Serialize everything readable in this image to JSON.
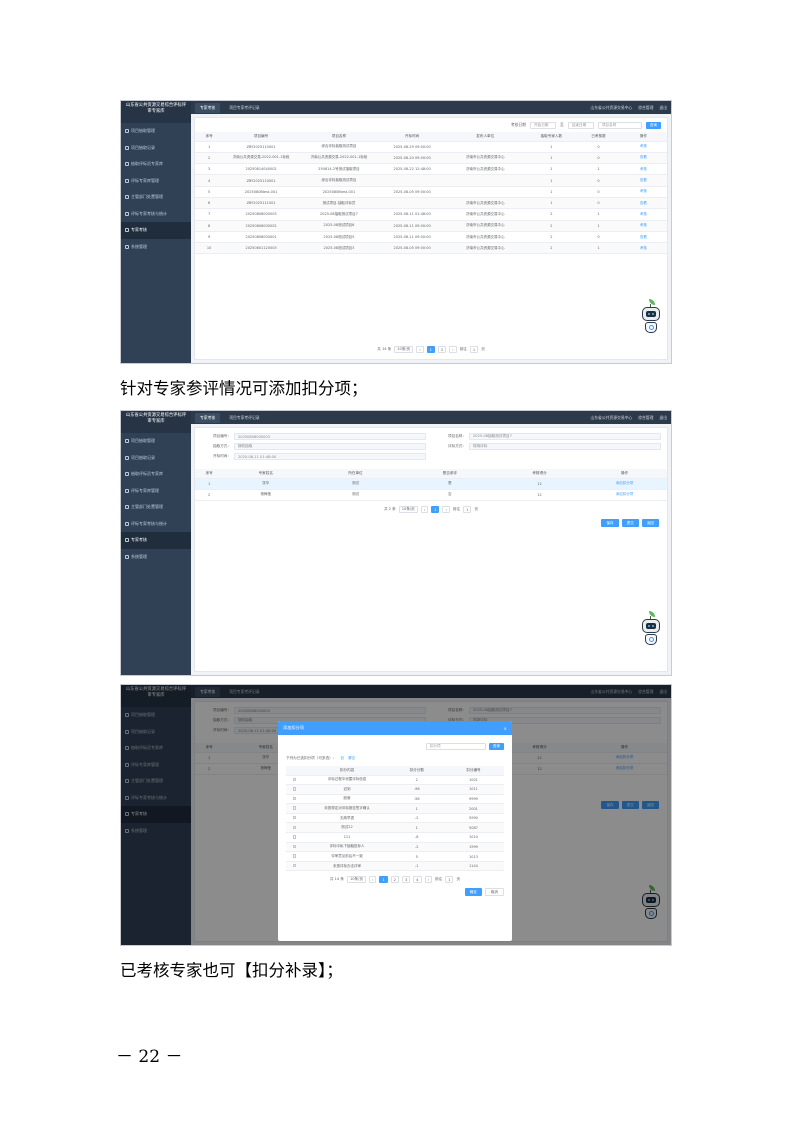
{
  "app": {
    "brand": "山东省公共资源交易综合评标评审专家库",
    "sidebar": [
      "项目抽取管理",
      "项目抽取记录",
      "抽取评标员专家库",
      "评标专家库管理",
      "主管部门处置管理",
      "评标专家考核与统计",
      "专家考核",
      "系统管理"
    ],
    "sidebar_active": 6,
    "tabs": [
      "专家考核",
      "项目专家考评记录"
    ],
    "top_right": [
      "山东省公共资源交易中心",
      "综合管理",
      "退出"
    ]
  },
  "shot1": {
    "filter": {
      "label": "考核日期",
      "range_start": "开始日期",
      "range_sep": "至",
      "range_end": "结束日期",
      "keyword": "项目名称",
      "search": "查询"
    },
    "columns": [
      "序号",
      "项目编号",
      "项目名称",
      "开标时间",
      "发布人单位",
      "抽取专家人数",
      "已考核数",
      "操作"
    ],
    "rows": [
      [
        "1",
        "ZBY2025110001",
        "综合评标抽取测试项目",
        "2025-08-29 09:00:00",
        "",
        "1",
        "0",
        "考核"
      ],
      [
        "2",
        "济南公共资源交易-2022-001-1标段",
        "济南公共资源交易-2022-001-1标段",
        "2025-08-20 09:00:00",
        "济南市公共资源交易中心",
        "1",
        "0",
        "查看"
      ],
      [
        "3",
        "20250814040002",
        "250814-2号测试抽取项目",
        "2025-08-22 12:48:00",
        "济南市公共资源交易中心",
        "1",
        "1",
        "考核"
      ],
      [
        "4",
        "ZBY2025110001",
        "综合评标抽取测试项目",
        "",
        "",
        "1",
        "0",
        "查看"
      ],
      [
        "5",
        "20250808test-001",
        "20250808test-001",
        "2025-08-05 09:00:00",
        "",
        "1",
        "0",
        "考核"
      ],
      [
        "6",
        "ZBY2025111001",
        "测试项目-抽取评标员",
        "",
        "济南市公共资源交易中心",
        "1",
        "0",
        "查看"
      ],
      [
        "7",
        "20250806000003",
        "2025-08抽取测试项目7",
        "2025-08-11 01:48:00",
        "济南市公共资源交易中心",
        "2",
        "1",
        "考核"
      ],
      [
        "8",
        "20250806000002",
        "2025-08测试项目6",
        "2025-08-11 09:00:00",
        "济南市公共资源交易中心",
        "2",
        "1",
        "考核"
      ],
      [
        "9",
        "20250806000001",
        "2025-08测试项目5",
        "2025-08-11 09:00:00",
        "济南市公共资源交易中心",
        "2",
        "0",
        "查看"
      ],
      [
        "10",
        "20250801120003",
        "2025-08测试项目3",
        "2025-08-05 09:00:00",
        "济南市公共资源交易中心",
        "2",
        "1",
        "考核"
      ]
    ],
    "pager": {
      "total": "共 14 条",
      "size": "10条/页",
      "pages": [
        "1",
        "2"
      ],
      "current": "1",
      "goto": "前往",
      "goto_value": "1",
      "goto_unit": "页"
    }
  },
  "caption1": "针对专家参评情况可添加扣分项；",
  "shot2": {
    "form": [
      {
        "label": "项目编号：",
        "value": "20250806000003"
      },
      {
        "label": "项目名称：",
        "value": "2025-08抽取测试项目7"
      },
      {
        "label": "抽取方式：",
        "value": "随机抽取"
      },
      {
        "label": "评标方式：",
        "value": "现场评标"
      },
      {
        "label": "开标时间：",
        "value": "2025-08-11 01:48:00"
      }
    ],
    "columns": [
      "序号",
      "专家姓名",
      "所在单位",
      "是否参评",
      "考核得分",
      "操作"
    ],
    "rows": [
      [
        "1",
        "张华",
        "测试",
        "是",
        "12",
        "添加扣分项"
      ],
      [
        "2",
        "杨梅莹",
        "测试",
        "否",
        "12",
        "添加扣分项"
      ]
    ],
    "pager": {
      "total": "共 2 条",
      "size": "10条/页",
      "pages": [
        "1"
      ],
      "current": "1",
      "goto": "前往",
      "goto_value": "1",
      "goto_unit": "页"
    },
    "buttons": [
      "保存",
      "提交",
      "返回"
    ]
  },
  "shot3": {
    "dialog_title": "添加扣分项",
    "close": "×",
    "search_placeholder": "扣分项",
    "search_btn": "查询",
    "hint": "下列为已选扣分项（可多选）：",
    "hint_a": "自",
    "hint_b": "清空",
    "columns": [
      "",
      "扣分内容",
      "扣分分数",
      "扣分编号"
    ],
    "rows": [
      [
        "",
        "评标过程中泄露评标信息",
        "2",
        "1001"
      ],
      [
        "",
        "迟到",
        "-96",
        "1011"
      ],
      [
        "",
        "缺席",
        "-98",
        "9999"
      ],
      [
        "",
        "未按规定对评标报告签字确认",
        "1",
        "2001"
      ],
      [
        "",
        "无故早退",
        "-2",
        "5990"
      ],
      [
        "",
        "测试22",
        "1",
        "5087"
      ],
      [
        "",
        "111",
        "-8",
        "1010"
      ],
      [
        "",
        "评标中私下接触投标人",
        "-2",
        "1999"
      ],
      [
        "",
        "评审意见前后不一致",
        "5",
        "1013"
      ],
      [
        "",
        "未按评标办法评审",
        "-1",
        "1144"
      ]
    ],
    "pager": {
      "total": "共 14 条",
      "size": "10条/页",
      "pages": [
        "1",
        "2",
        "3",
        "4"
      ],
      "current": "1",
      "goto": "前往",
      "goto_value": "1",
      "goto_unit": "页"
    },
    "ok": "确定",
    "cancel": "取消"
  },
  "caption2": "已考核专家也可【扣分补录】；",
  "page_number": "－ 22 －"
}
